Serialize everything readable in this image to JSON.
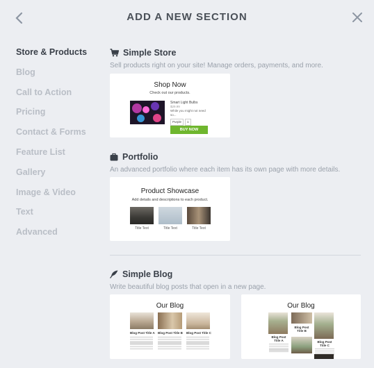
{
  "header": {
    "title": "ADD A NEW SECTION"
  },
  "nav": {
    "items": [
      {
        "label": "Store & Products",
        "active": true
      },
      {
        "label": "Blog"
      },
      {
        "label": "Call to Action"
      },
      {
        "label": "Pricing"
      },
      {
        "label": "Contact & Forms"
      },
      {
        "label": "Feature List"
      },
      {
        "label": "Gallery"
      },
      {
        "label": "Image & Video"
      },
      {
        "label": "Text"
      },
      {
        "label": "Advanced"
      }
    ]
  },
  "sections": {
    "store": {
      "title": "Simple Store",
      "description": "Sell products right on your site! Manage orders, payments, and more.",
      "icon": "cart-icon",
      "preview": {
        "heading": "Shop Now",
        "subheading": "Check out our products.",
        "product_name": "Smart Light Bulbs",
        "price": "$29.99",
        "blurb": "While you might not need so...",
        "color_option": "Purple",
        "quantity": "1",
        "button": "BUY NOW"
      }
    },
    "portfolio": {
      "title": "Portfolio",
      "description": "An advanced portfolio where each item has its own page with more details.",
      "icon": "briefcase-icon",
      "preview": {
        "heading": "Product Showcase",
        "subheading": "Add details and descriptions to each product.",
        "items": [
          {
            "caption": "Title Text"
          },
          {
            "caption": "Title Text"
          },
          {
            "caption": "Title Text"
          }
        ]
      }
    },
    "blog": {
      "title": "Simple Blog",
      "description": "Write beautiful blog posts that open in a new page.",
      "icon": "feather-icon",
      "preview_1": {
        "heading": "Our Blog",
        "posts": [
          {
            "title": "Blog Post Title A"
          },
          {
            "title": "Blog Post Title B"
          },
          {
            "title": "Blog Post Title C"
          }
        ]
      },
      "preview_2": {
        "heading": "Our Blog",
        "posts": [
          {
            "title": "Blog Post Title A"
          },
          {
            "title": "Blog Post Title B"
          },
          {
            "title": "Blog Post Title C"
          }
        ]
      }
    }
  },
  "colors": {
    "background": "#eceef2",
    "active_text": "#3a4049",
    "inactive_text": "#b9bec6",
    "buy_button": "#6fb62e"
  }
}
